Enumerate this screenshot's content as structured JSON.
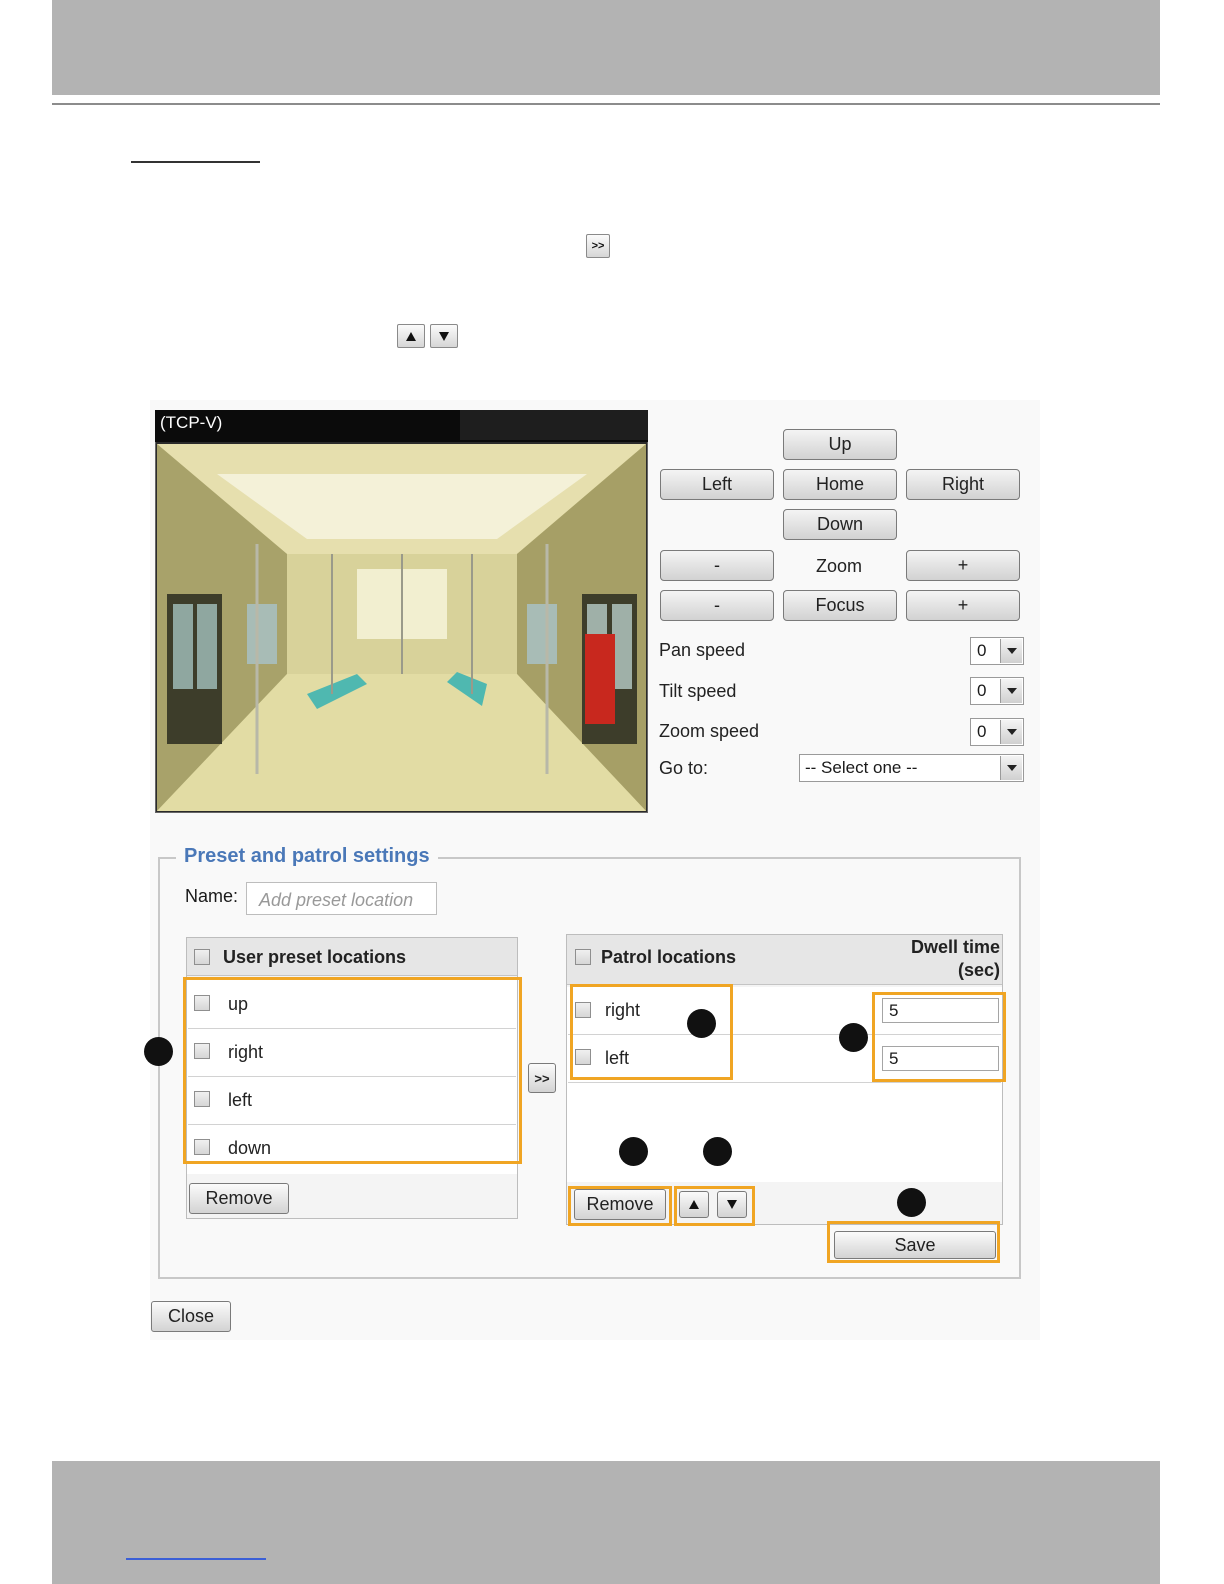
{
  "video": {
    "title": "(TCP-V)"
  },
  "ptz": {
    "up": "Up",
    "left": "Left",
    "home": "Home",
    "right": "Right",
    "down": "Down",
    "zoom_minus": "-",
    "zoom_label": "Zoom",
    "zoom_plus": "+",
    "focus_minus": "-",
    "focus_label": "Focus",
    "focus_plus": "+",
    "pan_speed_label": "Pan speed",
    "pan_speed_value": "0",
    "tilt_speed_label": "Tilt speed",
    "tilt_speed_value": "0",
    "zoom_speed_label": "Zoom speed",
    "zoom_speed_value": "0",
    "goto_label": "Go to:",
    "goto_value": "-- Select one --"
  },
  "preset": {
    "legend": "Preset and patrol settings",
    "name_label": "Name:",
    "name_placeholder": "Add preset location",
    "user_header": "User preset locations",
    "user_items": [
      "up",
      "right",
      "left",
      "down"
    ],
    "user_remove": "Remove",
    "add_button": ">>",
    "patrol_header": "Patrol locations",
    "dwell_header_1": "Dwell time",
    "dwell_header_2": "(sec)",
    "patrol_items": [
      {
        "name": "right",
        "dwell": "5"
      },
      {
        "name": "left",
        "dwell": "5"
      }
    ],
    "patrol_remove": "Remove",
    "save": "Save"
  },
  "close": "Close",
  "doc_icons": {
    "add": ">>"
  },
  "colors": {
    "highlight": "#f0a523",
    "legend": "#4a78b8",
    "bar": "#b3b3b3"
  }
}
